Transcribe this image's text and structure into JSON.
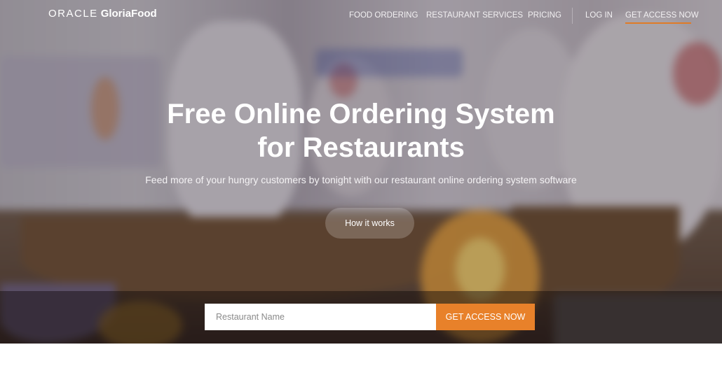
{
  "logo": {
    "oracle": "ORACLE",
    "brand": "GloriaFood"
  },
  "nav": {
    "items": [
      {
        "label": "FOOD ORDERING"
      },
      {
        "label": "RESTAURANT SERVICES"
      },
      {
        "label": "PRICING"
      },
      {
        "label": "LOG IN"
      },
      {
        "label": "GET ACCESS NOW",
        "active": true
      }
    ]
  },
  "hero": {
    "title_line1": "Free Online Ordering System",
    "title_line2": "for Restaurants",
    "subtitle": "Feed more of your hungry customers by tonight with our restaurant online ordering system software",
    "how_button": "How it works"
  },
  "signup": {
    "placeholder": "Restaurant Name",
    "value": "",
    "button": "GET ACCESS NOW"
  },
  "colors": {
    "accent": "#e8812a",
    "underline": "#e07b26",
    "text": "#ffffff"
  }
}
